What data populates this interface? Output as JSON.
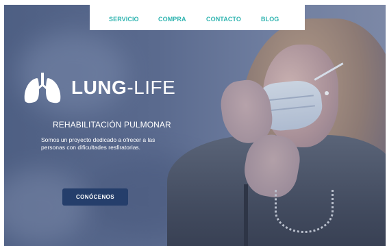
{
  "nav": {
    "items": [
      {
        "label": "SERVICIO"
      },
      {
        "label": "COMPRA"
      },
      {
        "label": "CONTACTO"
      },
      {
        "label": "BLOG"
      }
    ]
  },
  "hero": {
    "brand_bold": "LUNG",
    "brand_rest": "-LIFE",
    "subtitle": "REHABILITACIÓN PULMONAR",
    "description": "Somos un proyecto dedicado a ofrecer a las personas con dificultades resfiratorias.",
    "cta_label": "CONÓCENOS"
  },
  "colors": {
    "nav_link": "#2fb4b0",
    "cta_background": "#253e6b",
    "overlay": "#4e5f83"
  },
  "icons": {
    "logo": "lungs-icon"
  }
}
